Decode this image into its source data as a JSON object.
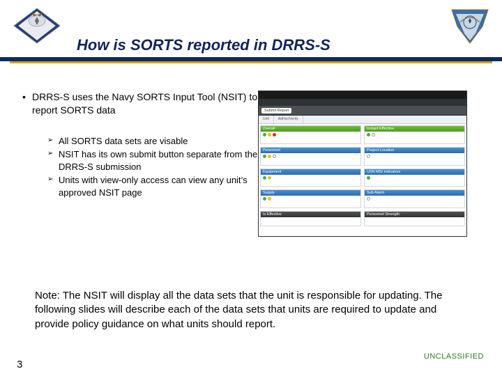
{
  "title": "How is SORTS reported in DRRS-S",
  "classification": "UNCLASSIFIED",
  "page_number": "3",
  "bullets": {
    "main": "DRRS-S uses the Navy SORTS Input Tool (NSIT) to report SORTS data",
    "subs": [
      "All SORTS data sets are visable",
      "NSIT has its own submit button separate from the DRRS-S submission",
      "Units with view-only access can view any unit’s approved NSIT page"
    ]
  },
  "note": "Note: The NSIT will display all the data sets that the unit is responsible for updating. The following slides will describe each of the data sets that units are required to update and provide policy guidance on what units should report.",
  "screenshot": {
    "chip": "Submit Report",
    "tabs": [
      "Unit",
      "AdHoc/Verify"
    ],
    "panels": [
      {
        "title": "Overall",
        "theme": "green"
      },
      {
        "title": "Instant Effective",
        "theme": "green"
      },
      {
        "title": "Personnel",
        "theme": "blue"
      },
      {
        "title": "Project Location",
        "theme": "blue"
      },
      {
        "title": "Equipment",
        "theme": "blue"
      },
      {
        "title": "USN MSI Indicators",
        "theme": "blue"
      },
      {
        "title": "Supply",
        "theme": "blue"
      },
      {
        "title": "Sub Alarm",
        "theme": "blue"
      },
      {
        "title": "Is Effective",
        "theme": "dark"
      },
      {
        "title": "Personnel Strength",
        "theme": "dark"
      }
    ]
  }
}
